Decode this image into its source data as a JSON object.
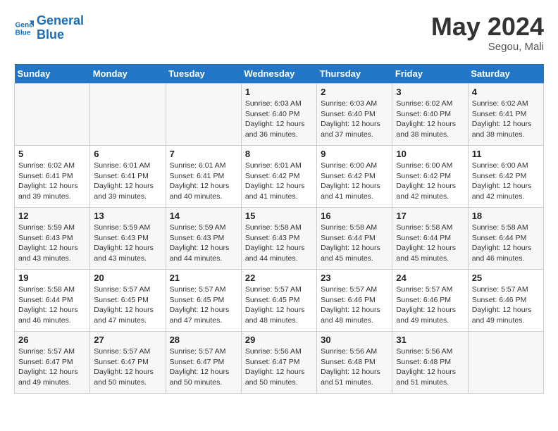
{
  "header": {
    "logo_line1": "General",
    "logo_line2": "Blue",
    "month": "May 2024",
    "location": "Segou, Mali"
  },
  "weekdays": [
    "Sunday",
    "Monday",
    "Tuesday",
    "Wednesday",
    "Thursday",
    "Friday",
    "Saturday"
  ],
  "weeks": [
    [
      {
        "num": "",
        "info": ""
      },
      {
        "num": "",
        "info": ""
      },
      {
        "num": "",
        "info": ""
      },
      {
        "num": "1",
        "info": "Sunrise: 6:03 AM\nSunset: 6:40 PM\nDaylight: 12 hours\nand 36 minutes."
      },
      {
        "num": "2",
        "info": "Sunrise: 6:03 AM\nSunset: 6:40 PM\nDaylight: 12 hours\nand 37 minutes."
      },
      {
        "num": "3",
        "info": "Sunrise: 6:02 AM\nSunset: 6:40 PM\nDaylight: 12 hours\nand 38 minutes."
      },
      {
        "num": "4",
        "info": "Sunrise: 6:02 AM\nSunset: 6:41 PM\nDaylight: 12 hours\nand 38 minutes."
      }
    ],
    [
      {
        "num": "5",
        "info": "Sunrise: 6:02 AM\nSunset: 6:41 PM\nDaylight: 12 hours\nand 39 minutes."
      },
      {
        "num": "6",
        "info": "Sunrise: 6:01 AM\nSunset: 6:41 PM\nDaylight: 12 hours\nand 39 minutes."
      },
      {
        "num": "7",
        "info": "Sunrise: 6:01 AM\nSunset: 6:41 PM\nDaylight: 12 hours\nand 40 minutes."
      },
      {
        "num": "8",
        "info": "Sunrise: 6:01 AM\nSunset: 6:42 PM\nDaylight: 12 hours\nand 41 minutes."
      },
      {
        "num": "9",
        "info": "Sunrise: 6:00 AM\nSunset: 6:42 PM\nDaylight: 12 hours\nand 41 minutes."
      },
      {
        "num": "10",
        "info": "Sunrise: 6:00 AM\nSunset: 6:42 PM\nDaylight: 12 hours\nand 42 minutes."
      },
      {
        "num": "11",
        "info": "Sunrise: 6:00 AM\nSunset: 6:42 PM\nDaylight: 12 hours\nand 42 minutes."
      }
    ],
    [
      {
        "num": "12",
        "info": "Sunrise: 5:59 AM\nSunset: 6:43 PM\nDaylight: 12 hours\nand 43 minutes."
      },
      {
        "num": "13",
        "info": "Sunrise: 5:59 AM\nSunset: 6:43 PM\nDaylight: 12 hours\nand 43 minutes."
      },
      {
        "num": "14",
        "info": "Sunrise: 5:59 AM\nSunset: 6:43 PM\nDaylight: 12 hours\nand 44 minutes."
      },
      {
        "num": "15",
        "info": "Sunrise: 5:58 AM\nSunset: 6:43 PM\nDaylight: 12 hours\nand 44 minutes."
      },
      {
        "num": "16",
        "info": "Sunrise: 5:58 AM\nSunset: 6:44 PM\nDaylight: 12 hours\nand 45 minutes."
      },
      {
        "num": "17",
        "info": "Sunrise: 5:58 AM\nSunset: 6:44 PM\nDaylight: 12 hours\nand 45 minutes."
      },
      {
        "num": "18",
        "info": "Sunrise: 5:58 AM\nSunset: 6:44 PM\nDaylight: 12 hours\nand 46 minutes."
      }
    ],
    [
      {
        "num": "19",
        "info": "Sunrise: 5:58 AM\nSunset: 6:44 PM\nDaylight: 12 hours\nand 46 minutes."
      },
      {
        "num": "20",
        "info": "Sunrise: 5:57 AM\nSunset: 6:45 PM\nDaylight: 12 hours\nand 47 minutes."
      },
      {
        "num": "21",
        "info": "Sunrise: 5:57 AM\nSunset: 6:45 PM\nDaylight: 12 hours\nand 47 minutes."
      },
      {
        "num": "22",
        "info": "Sunrise: 5:57 AM\nSunset: 6:45 PM\nDaylight: 12 hours\nand 48 minutes."
      },
      {
        "num": "23",
        "info": "Sunrise: 5:57 AM\nSunset: 6:46 PM\nDaylight: 12 hours\nand 48 minutes."
      },
      {
        "num": "24",
        "info": "Sunrise: 5:57 AM\nSunset: 6:46 PM\nDaylight: 12 hours\nand 49 minutes."
      },
      {
        "num": "25",
        "info": "Sunrise: 5:57 AM\nSunset: 6:46 PM\nDaylight: 12 hours\nand 49 minutes."
      }
    ],
    [
      {
        "num": "26",
        "info": "Sunrise: 5:57 AM\nSunset: 6:47 PM\nDaylight: 12 hours\nand 49 minutes."
      },
      {
        "num": "27",
        "info": "Sunrise: 5:57 AM\nSunset: 6:47 PM\nDaylight: 12 hours\nand 50 minutes."
      },
      {
        "num": "28",
        "info": "Sunrise: 5:57 AM\nSunset: 6:47 PM\nDaylight: 12 hours\nand 50 minutes."
      },
      {
        "num": "29",
        "info": "Sunrise: 5:56 AM\nSunset: 6:47 PM\nDaylight: 12 hours\nand 50 minutes."
      },
      {
        "num": "30",
        "info": "Sunrise: 5:56 AM\nSunset: 6:48 PM\nDaylight: 12 hours\nand 51 minutes."
      },
      {
        "num": "31",
        "info": "Sunrise: 5:56 AM\nSunset: 6:48 PM\nDaylight: 12 hours\nand 51 minutes."
      },
      {
        "num": "",
        "info": ""
      }
    ]
  ]
}
